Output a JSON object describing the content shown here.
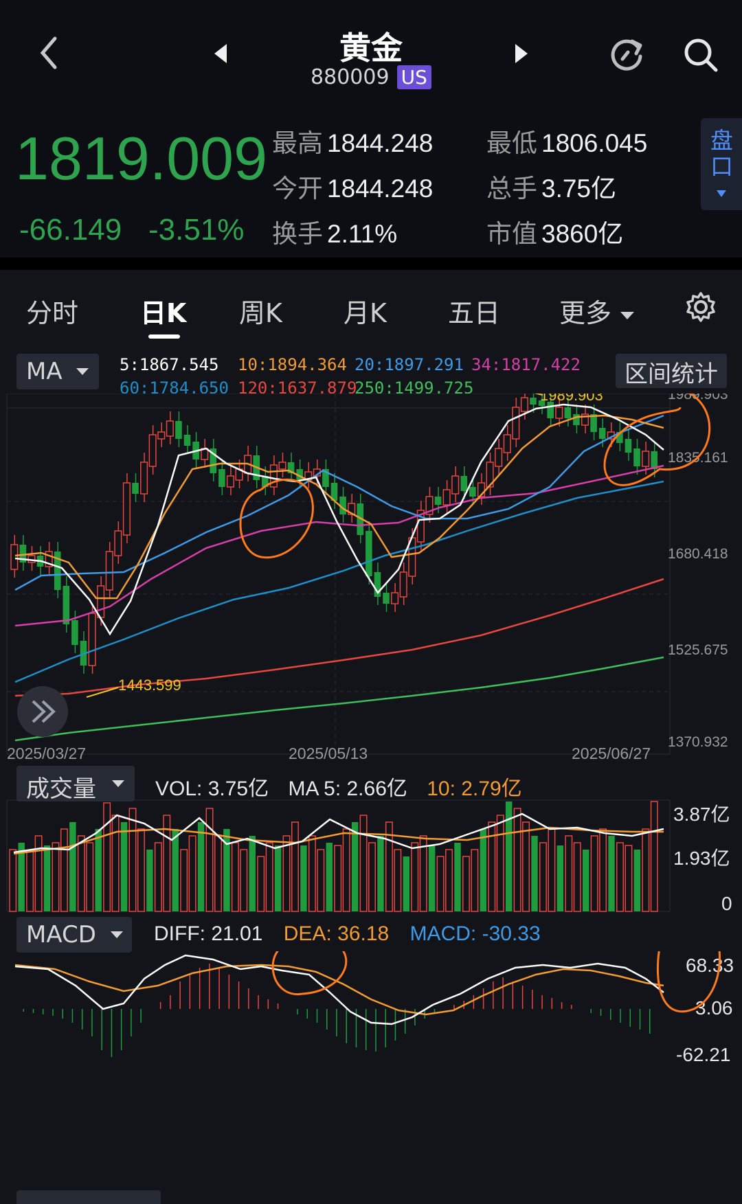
{
  "header": {
    "title": "黄金",
    "code": "880009",
    "market_badge": "US"
  },
  "quote": {
    "price": "1819.009",
    "change": "-66.149",
    "change_pct": "-3.51%",
    "stats": [
      {
        "label": "最高",
        "value": "1844.248"
      },
      {
        "label": "最低",
        "value": "1806.045"
      },
      {
        "label": "今开",
        "value": "1844.248"
      },
      {
        "label": "总手",
        "value": "3.75亿"
      },
      {
        "label": "换手",
        "value": "2.11%"
      },
      {
        "label": "市值",
        "value": "3860亿"
      }
    ],
    "panel_button": "盘口"
  },
  "tabs": {
    "items": [
      "分时",
      "日K",
      "周K",
      "月K",
      "五日",
      "更多"
    ],
    "active": "日K"
  },
  "ma": {
    "selector": "MA",
    "range_stat_button": "区间统计",
    "entries": [
      {
        "text": "5:1867.545",
        "color": "#ffffff"
      },
      {
        "text": "10:1894.364",
        "color": "#f39c32"
      },
      {
        "text": "20:1897.291",
        "color": "#3d9be8"
      },
      {
        "text": "34:1817.422",
        "color": "#d63fa7"
      },
      {
        "text": "60:1784.650",
        "color": "#1f8fc9"
      },
      {
        "text": "120:1637.879",
        "color": "#e8473f"
      },
      {
        "text": "250:1499.725",
        "color": "#3fbf5a"
      }
    ]
  },
  "price_axis": [
    "1989.903",
    "1835.161",
    "1680.418",
    "1525.675",
    "1370.932"
  ],
  "date_axis": [
    "2025/03/27",
    "2025/05/13",
    "2025/06/27"
  ],
  "annotations": {
    "high": "1989.903",
    "low": "1443.599"
  },
  "volume": {
    "selector": "成交量",
    "vol_label": "VOL:",
    "vol_value": "3.75亿",
    "ma5_label": "MA 5:",
    "ma5_value": "2.66亿",
    "ma10_label": "10:",
    "ma10_value": "2.79亿",
    "axis": [
      "3.87亿",
      "1.93亿",
      "0"
    ]
  },
  "macd": {
    "selector": "MACD",
    "diff_label": "DIFF:",
    "diff_value": "21.01",
    "dea_label": "DEA:",
    "dea_value": "36.18",
    "macd_label": "MACD:",
    "macd_value": "-30.33",
    "axis": [
      "68.33",
      "3.06",
      "-62.21"
    ]
  },
  "colors": {
    "up": "#e8473f",
    "down": "#1f9c3e",
    "price_green": "#2ea44f",
    "badge": "#6b4fd8",
    "marker_orange": "#ff7a1a"
  }
}
